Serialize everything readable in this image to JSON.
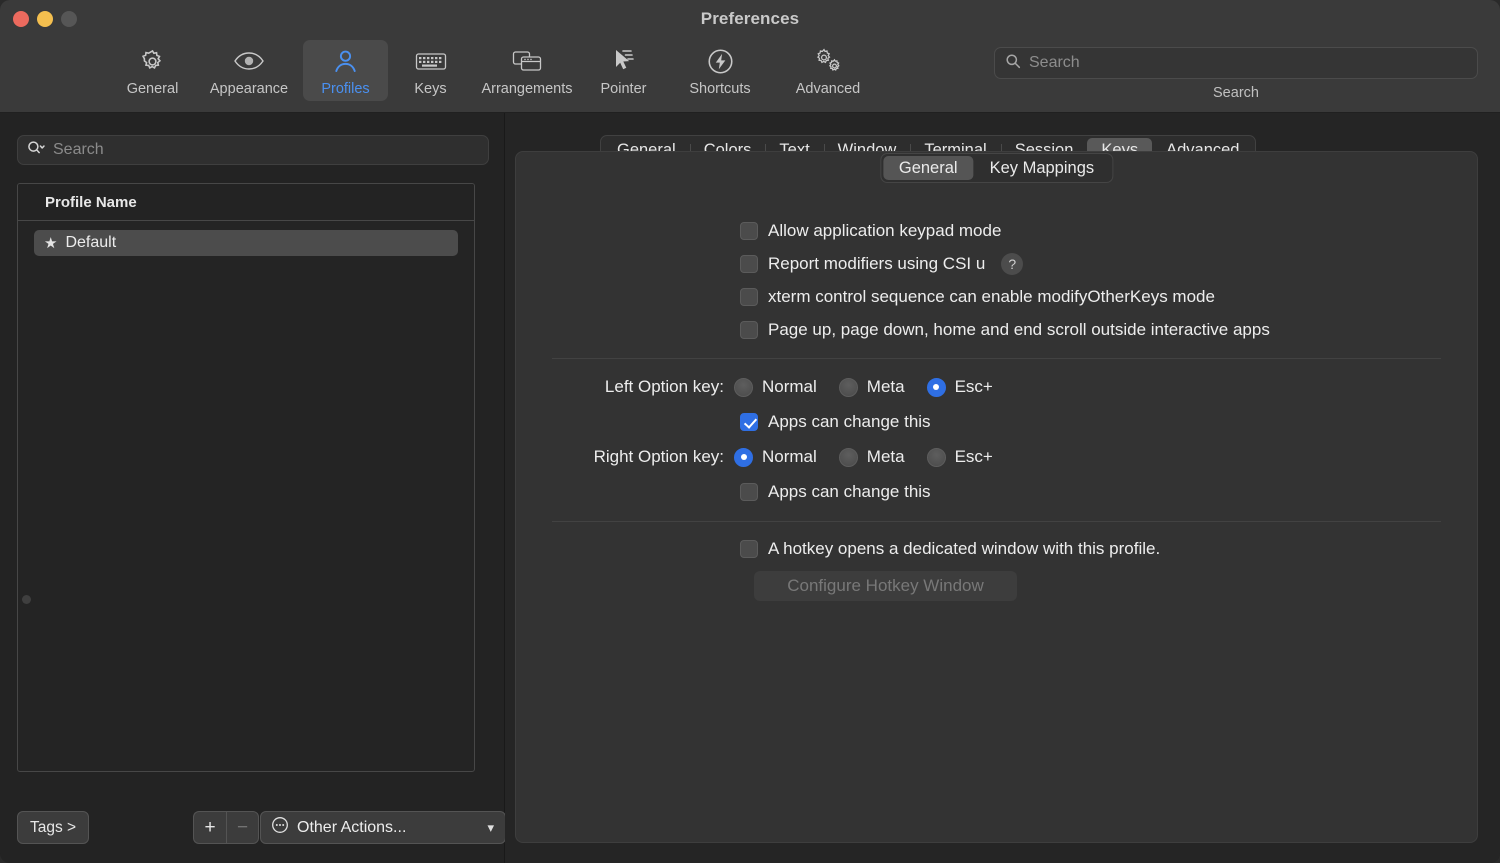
{
  "window": {
    "title": "Preferences",
    "traffic_lights": [
      "close",
      "minimize",
      "zoom"
    ]
  },
  "toolbar": {
    "items": [
      {
        "label": "General",
        "icon": "gear-icon",
        "selected": false
      },
      {
        "label": "Appearance",
        "icon": "eye-icon",
        "selected": false
      },
      {
        "label": "Profiles",
        "icon": "person-icon",
        "selected": true
      },
      {
        "label": "Keys",
        "icon": "keyboard-icon",
        "selected": false
      },
      {
        "label": "Arrangements",
        "icon": "windows-icon",
        "selected": false
      },
      {
        "label": "Pointer",
        "icon": "cursor-icon",
        "selected": false
      },
      {
        "label": "Shortcuts",
        "icon": "bolt-circle-icon",
        "selected": false
      },
      {
        "label": "Advanced",
        "icon": "two-gears-icon",
        "selected": false
      }
    ],
    "search": {
      "placeholder": "Search",
      "value": "",
      "caption": "Search",
      "icon": "search-icon"
    }
  },
  "sidebar": {
    "search": {
      "placeholder": "Search",
      "value": "",
      "icon": "search-dropdown-icon"
    },
    "table": {
      "column_header": "Profile Name",
      "rows": [
        {
          "name": "Default",
          "icon": "star-icon",
          "selected": true
        }
      ]
    },
    "footer": {
      "tags_label": "Tags >",
      "add_label": "+",
      "remove_label": "−",
      "other_actions_label": "Other Actions...",
      "other_actions_icon": "ellipsis-circle-icon",
      "chevron_icon": "chevron-down-icon"
    }
  },
  "content": {
    "tabs": [
      {
        "label": "General",
        "selected": false
      },
      {
        "label": "Colors",
        "selected": false
      },
      {
        "label": "Text",
        "selected": false
      },
      {
        "label": "Window",
        "selected": false
      },
      {
        "label": "Terminal",
        "selected": false
      },
      {
        "label": "Session",
        "selected": false
      },
      {
        "label": "Keys",
        "selected": true
      },
      {
        "label": "Advanced",
        "selected": false
      }
    ],
    "subtabs": [
      {
        "label": "General",
        "selected": true
      },
      {
        "label": "Key Mappings",
        "selected": false
      }
    ],
    "checkboxes": [
      {
        "label": "Allow application keypad mode",
        "checked": false,
        "help": false
      },
      {
        "label": "Report modifiers using CSI u",
        "checked": false,
        "help": true,
        "help_glyph": "?"
      },
      {
        "label": "xterm control sequence can enable modifyOtherKeys mode",
        "checked": false,
        "help": false
      },
      {
        "label": "Page up, page down, home and end scroll outside interactive apps",
        "checked": false,
        "help": false
      }
    ],
    "option_keys": [
      {
        "label": "Left Option key:",
        "options": [
          {
            "label": "Normal",
            "selected": false
          },
          {
            "label": "Meta",
            "selected": false
          },
          {
            "label": "Esc+",
            "selected": true
          }
        ],
        "apps_can_change": {
          "label": "Apps can change this",
          "checked": true
        }
      },
      {
        "label": "Right Option key:",
        "options": [
          {
            "label": "Normal",
            "selected": true
          },
          {
            "label": "Meta",
            "selected": false
          },
          {
            "label": "Esc+",
            "selected": false
          }
        ],
        "apps_can_change": {
          "label": "Apps can change this",
          "checked": false
        }
      }
    ],
    "hotkey": {
      "checkbox_label": "A hotkey opens a dedicated window with this profile.",
      "checked": false,
      "button_label": "Configure Hotkey Window",
      "button_disabled": true
    }
  },
  "colors": {
    "accent": "#2f6fe4",
    "traffic_red": "#ec6a5e",
    "traffic_yellow": "#f4bf4f",
    "traffic_gray": "#565656",
    "toolbar_bg": "#3a3a3a",
    "panel_bg": "#333333",
    "sidebar_bg": "#232323"
  }
}
